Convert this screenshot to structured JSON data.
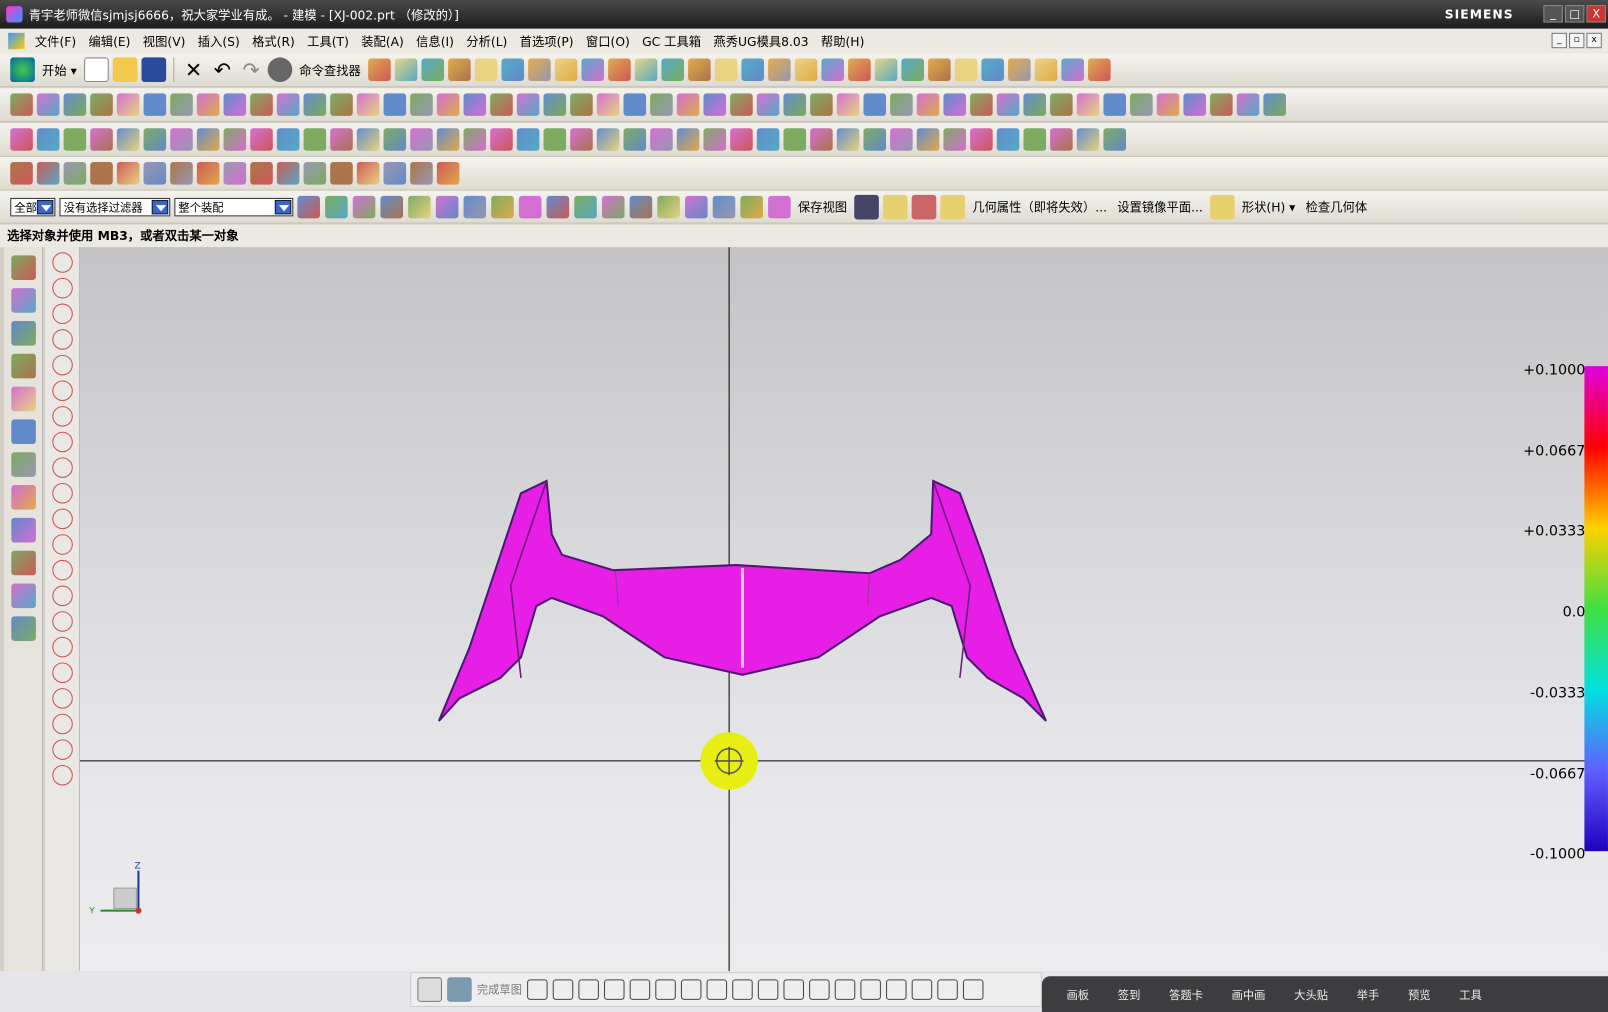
{
  "window": {
    "title": "青宇老师微信sjmjsj6666，祝大家学业有成。 - 建模 - [XJ-002.prt （修改的）]",
    "brand": "SIEMENS",
    "buttons": [
      "_",
      "□",
      "X"
    ]
  },
  "menu": [
    "文件(F)",
    "编辑(E)",
    "视图(V)",
    "插入(S)",
    "格式(R)",
    "工具(T)",
    "装配(A)",
    "信息(I)",
    "分析(L)",
    "首选项(P)",
    "窗口(O)",
    "GC 工具箱",
    "燕秀UG模具8.03",
    "帮助(H)"
  ],
  "toolbar1": {
    "start": "开始 ▾",
    "command_finder": "命令查找器"
  },
  "filterbar": {
    "type_filter": "全部",
    "selection_filter": "没有选择过滤器",
    "scope": "整个装配",
    "save_view": "保存视图",
    "geom_props": "几何属性（即将失效）...",
    "mirror_plane": "设置镜像平面...",
    "shape": "形状(H) ▾",
    "check_geometry": "检查几何体"
  },
  "status": {
    "prompt": "选择对象并使用 MB3，或者双击某一对象"
  },
  "legend": {
    "labels": [
      "+0.1000",
      "+0.0667",
      "+0.0333",
      "0.0",
      "-0.0333",
      "-0.0667",
      "-0.1000"
    ],
    "colors": [
      "#e000e0",
      "#ff0000",
      "#ffd000",
      "#40e040",
      "#00e0e0",
      "#6060ff",
      "#2000c0"
    ]
  },
  "part": {
    "color": "#e61ee6"
  },
  "triad": {
    "z": "Z",
    "y": "Y"
  },
  "sketch": {
    "finish": "完成草图"
  },
  "overlay": {
    "items": [
      "画板",
      "签到",
      "答题卡",
      "画中画",
      "大头贴",
      "举手",
      "预览",
      "工具"
    ]
  }
}
